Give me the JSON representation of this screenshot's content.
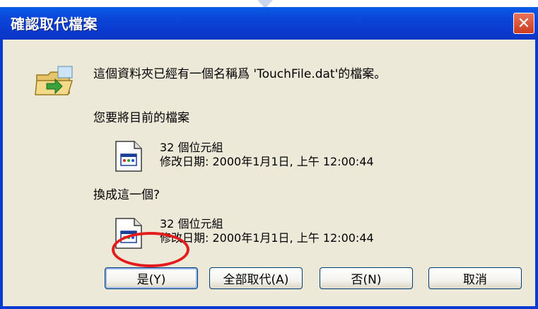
{
  "dialog": {
    "title": "確認取代檔案",
    "close_symbol": "✕",
    "message": "這個資料夾已經有一個名稱爲 'TouchFile.dat'的檔案。",
    "replace_prompt": "您要將目前的檔案",
    "with_prompt": "換成這一個?",
    "existing_file": {
      "size": "32 個位元組",
      "modified": "修改日期: 2000年1月1日, 上午 12:00:44"
    },
    "new_file": {
      "size": "32 個位元組",
      "modified": "修改日期: 2000年1月1日, 上午 12:00:44"
    },
    "buttons": {
      "yes": "是(Y)",
      "yes_to_all": "全部取代(A)",
      "no": "否(N)",
      "cancel": "取消"
    }
  },
  "colors": {
    "titlebar": "#0b46d8",
    "client": "#ece9d8",
    "highlight": "#e41c1c",
    "close": "#cc3b1f"
  },
  "icons": {
    "folder": "folder-replace-icon",
    "file": "file-icon",
    "close": "close-icon"
  }
}
